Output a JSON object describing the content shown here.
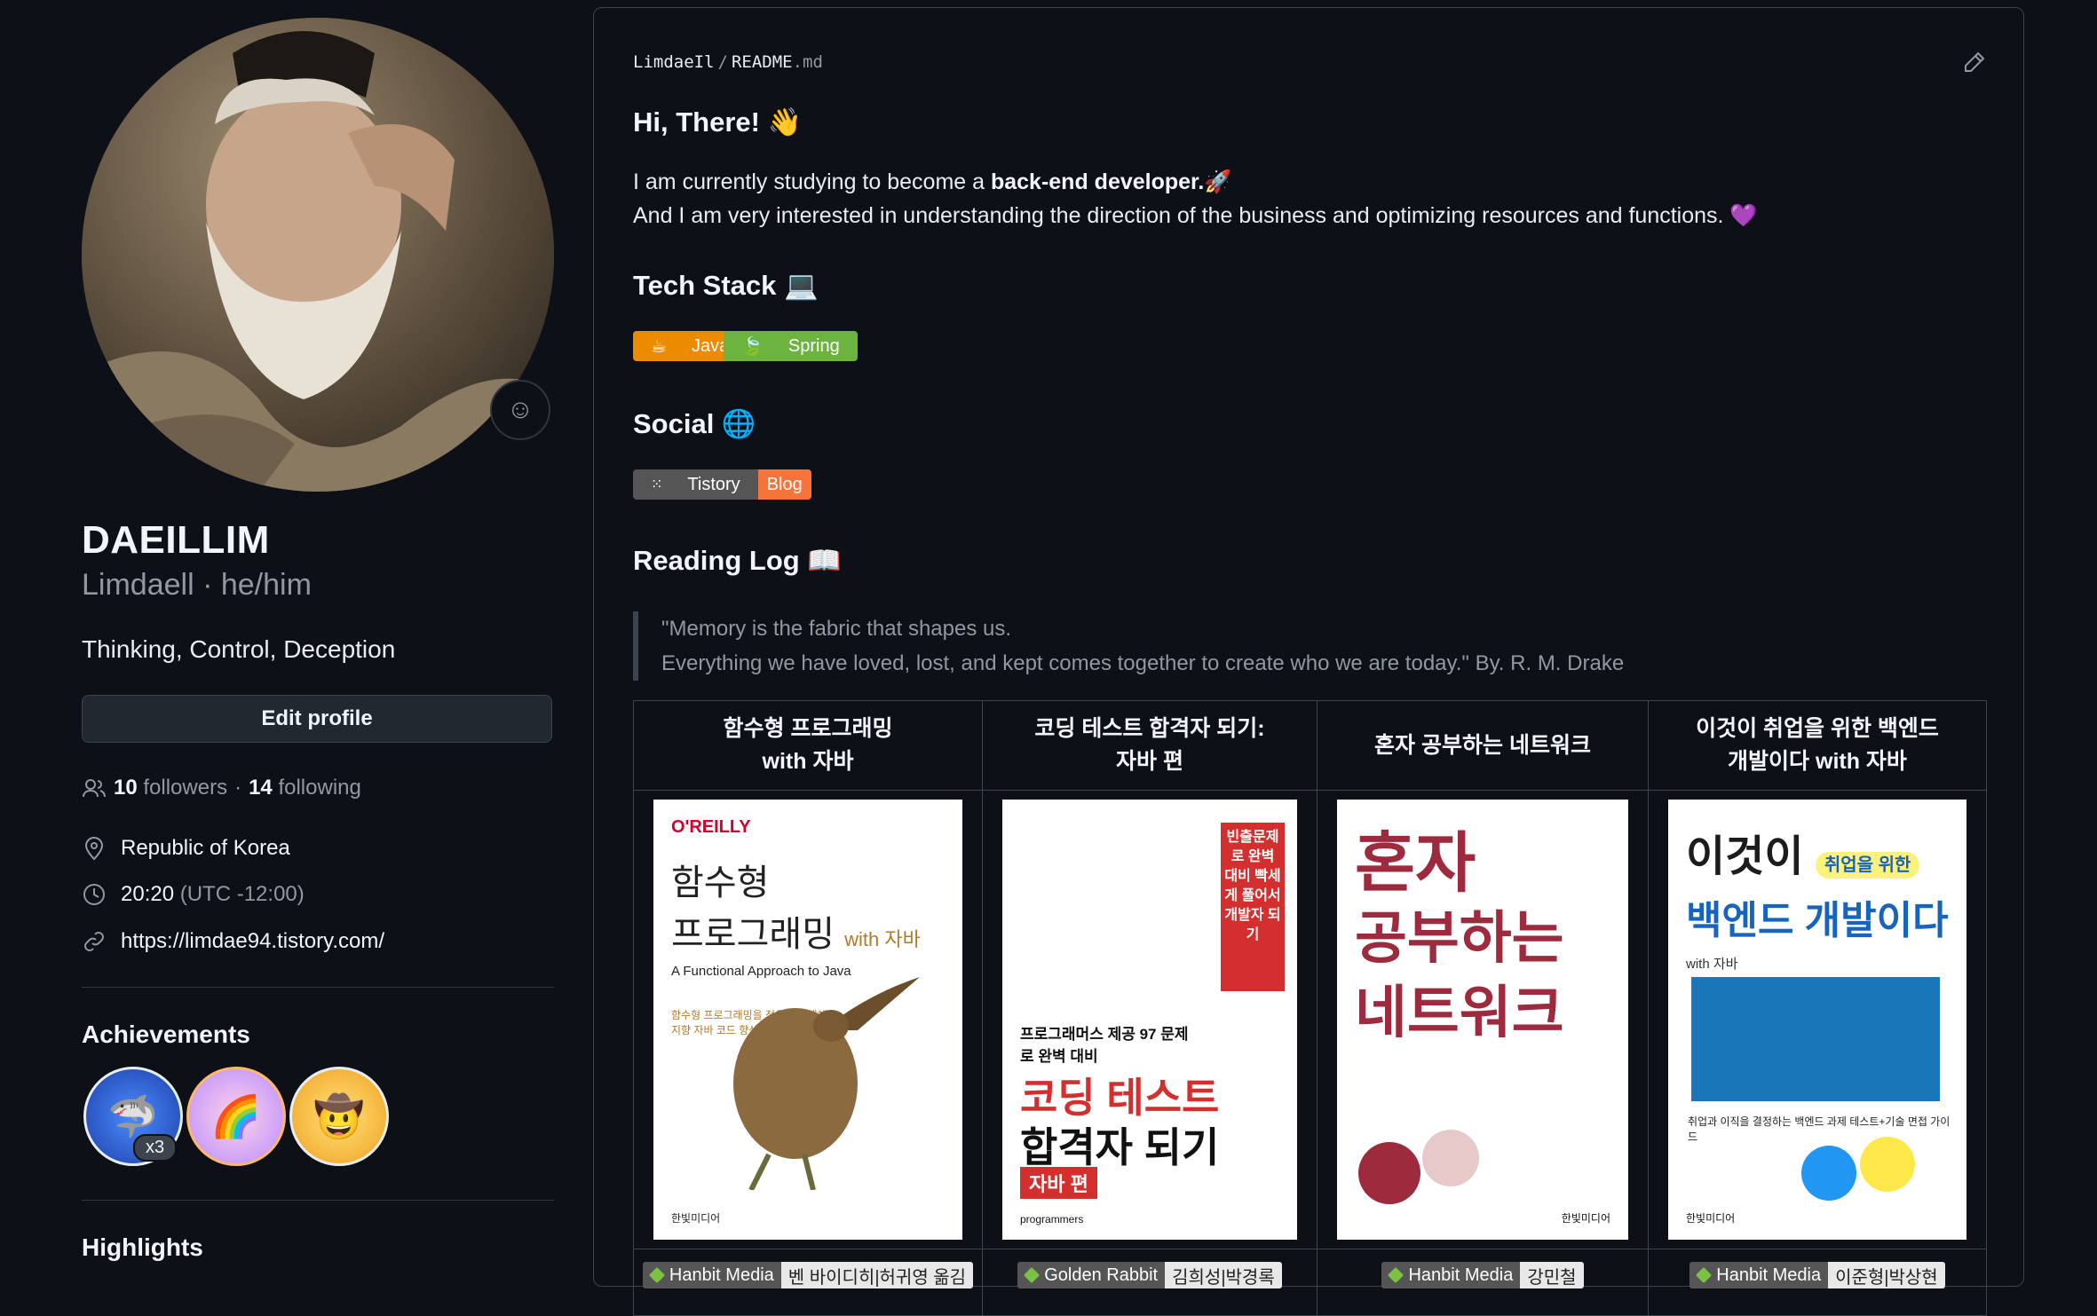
{
  "profile": {
    "name": "DAEILLIM",
    "login_pronouns": "Limdaell · he/him",
    "bio": "Thinking, Control, Deception",
    "edit_button": "Edit profile",
    "followers_count": "10",
    "followers_label": "followers",
    "separator": "·",
    "following_count": "14",
    "following_label": "following",
    "location": "Republic of Korea",
    "local_time": "20:20",
    "timezone": "(UTC -12:00)",
    "website": "https://limdae94.tistory.com/",
    "achievements_title": "Achievements",
    "achievement_count": "x3",
    "highlights_title": "Highlights"
  },
  "readme": {
    "path_user": "LimdaeIl",
    "path_sep": "/",
    "path_file": "README",
    "path_ext": ".md",
    "greeting": "Hi, There! 👋",
    "line1_pre": "I am currently studying to become a ",
    "line1_bold": "back-end developer.",
    "line1_emoji": "🚀",
    "line2": "And I am very interested in understanding the direction of the business and optimizing resources and functions. 💜",
    "tech_title": "Tech Stack 💻",
    "tech_badges": [
      "Java",
      "Spring"
    ],
    "social_title": "Social 🌐",
    "social_left": "Tistory",
    "social_right": "Blog",
    "reading_title": "Reading Log 📖",
    "quote_line1": "\"Memory is the fabric that shapes us.",
    "quote_line2": "Everything we have loved, lost, and kept comes together to create who we are today.\" By. R. M. Drake"
  },
  "books": [
    {
      "title_1": "함수형 프로그래밍",
      "title_2": "with 자바",
      "publisher": "Hanbit Media",
      "authors": "벤 바이디히|허귀영 옮김",
      "cover_brand": "O'REILLY",
      "cover_t1": "함수형",
      "cover_t2": "프로그래밍",
      "cover_t3": "with 자바",
      "cover_sub": "A Functional Approach to Java",
      "cover_desc": "함수형 프로그래밍을 적용하여 객체 지향 자바 코드 향상시키기",
      "cover_footer": "한빛미디어"
    },
    {
      "title_1": "코딩 테스트 합격자 되기:",
      "title_2": "자바 편",
      "publisher": "Golden Rabbit",
      "authors": "김희성|박경록",
      "cover_t1": "코딩 테스트",
      "cover_t2": "합격자 되기",
      "cover_tag": "자바 편",
      "cover_sub": "프로그래머스 제공 97 문제로 완벽 대비",
      "cover_side": "빈출문제로 완벽 대비 빡세게 풀어서 개발자 되기",
      "cover_footer": "programmers"
    },
    {
      "title_1": "혼자 공부하는 네트워크",
      "title_2": "",
      "publisher": "Hanbit Media",
      "authors": "강민철",
      "cover_t1": "혼자",
      "cover_t2": "공부하는",
      "cover_t3": "네트워크",
      "cover_footer": "한빛미디어"
    },
    {
      "title_1": "이것이 취업을 위한 백엔드",
      "title_2": "개발이다 with 자바",
      "publisher": "Hanbit Media",
      "authors": "이준형|박상현",
      "cover_t1": "이것이",
      "cover_t2": "취업을 위한",
      "cover_t3": "백엔드 개발이다",
      "cover_t4": "with 자바",
      "cover_desc": "취업과 이직을 결정하는 백엔드 과제 테스트+기술 면접 가이드",
      "cover_footer": "한빛미디어"
    }
  ],
  "colors": {
    "java": "#ED8B00",
    "spring": "#6DB33F",
    "tistory": "#555555",
    "blog": "#F4743B"
  }
}
